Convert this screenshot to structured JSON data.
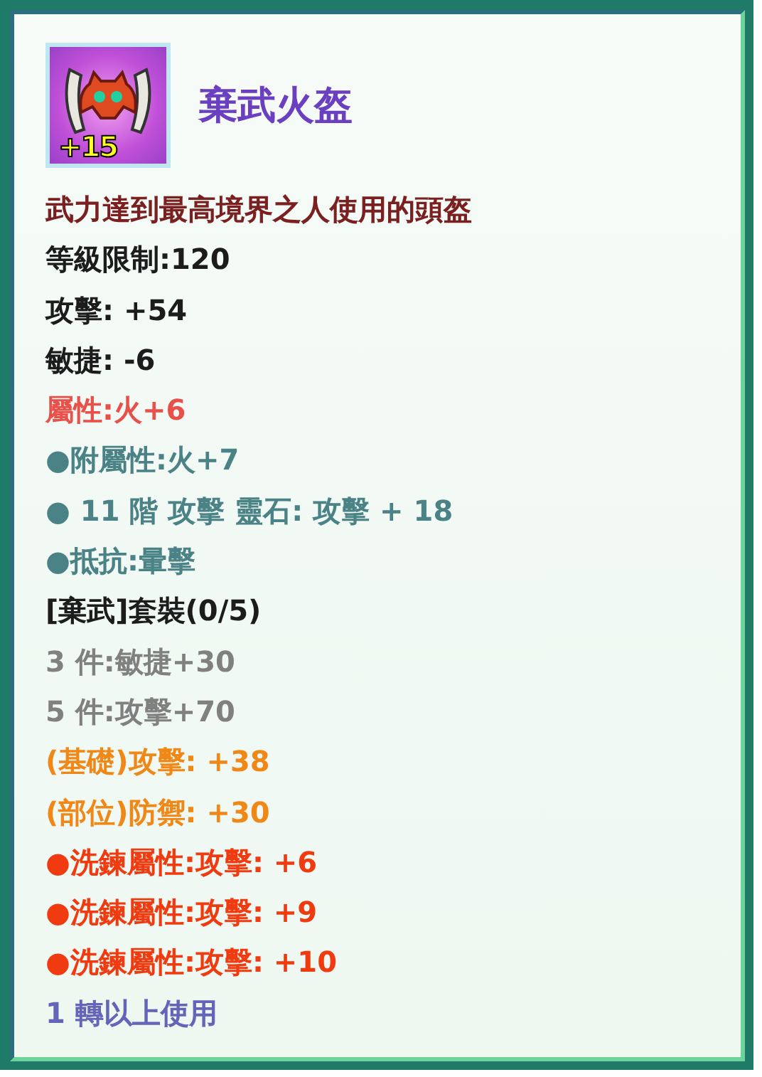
{
  "item": {
    "name": "棄武火盔",
    "enhance": "+15"
  },
  "lines": [
    {
      "text": "武力達到最高境界之人使用的頭盔",
      "color": "#7a2020"
    },
    {
      "text": "等級限制:120",
      "color": "#1c1c1c"
    },
    {
      "text": "攻擊: +54",
      "color": "#1c1c1c"
    },
    {
      "text": "敏捷: -6",
      "color": "#1c1c1c"
    },
    {
      "text": "屬性:火+6",
      "color": "#e8504a"
    },
    {
      "text": "●附屬性:火+7",
      "color": "#4a8286"
    },
    {
      "text": "● 11 階 攻擊 靈石: 攻擊 + 18",
      "color": "#4a8286"
    },
    {
      "text": "●抵抗:暈擊",
      "color": "#4a8286"
    },
    {
      "text": "[棄武]套裝(0/5)",
      "color": "#1c1c1c"
    },
    {
      "text": "3 件:敏捷+30",
      "color": "#808080"
    },
    {
      "text": "5 件:攻擊+70",
      "color": "#808080"
    },
    {
      "text": "(基礎)攻擊: +38",
      "color": "#f08818"
    },
    {
      "text": "(部位)防禦: +30",
      "color": "#f08818"
    },
    {
      "text": "●洗鍊屬性:攻擊: +6",
      "color": "#f03a10"
    },
    {
      "text": "●洗鍊屬性:攻擊: +9",
      "color": "#f03a10"
    },
    {
      "text": "●洗鍊屬性:攻擊: +10",
      "color": "#f03a10"
    },
    {
      "text": "1 轉以上使用",
      "color": "#6464b8"
    }
  ]
}
